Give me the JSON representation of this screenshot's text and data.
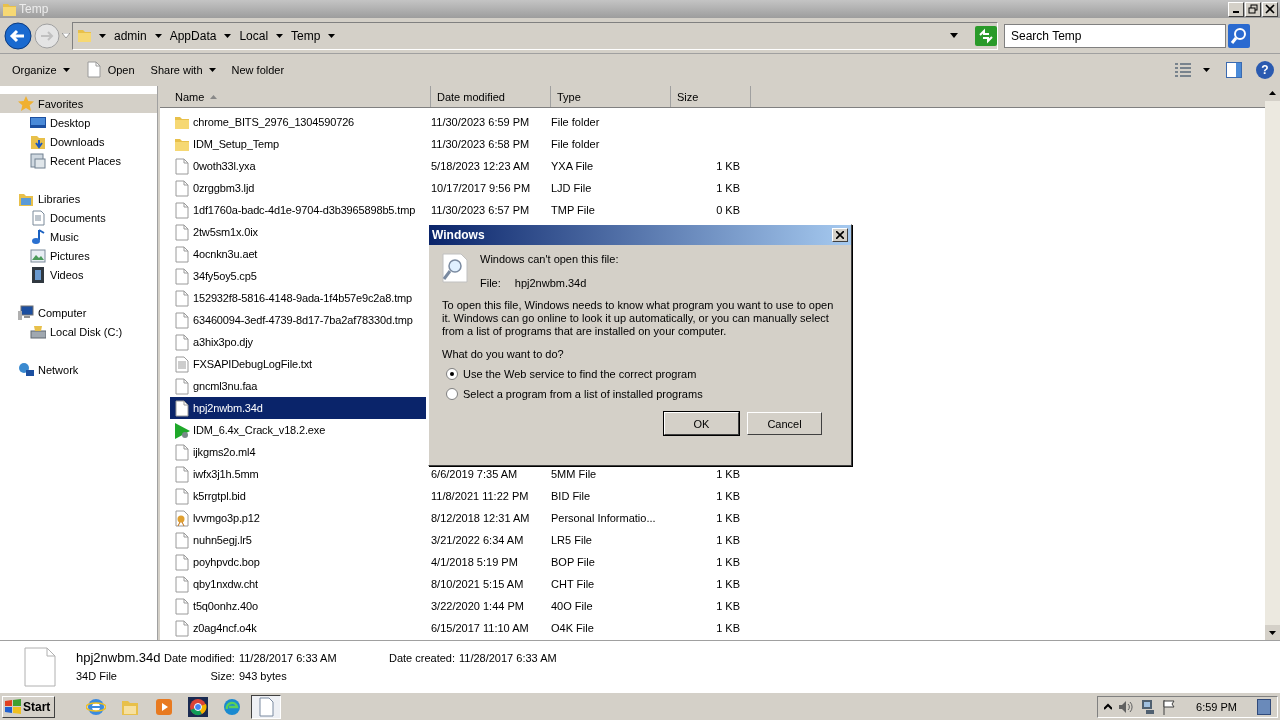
{
  "window": {
    "title": "Temp"
  },
  "address": {
    "crumbs": [
      "admin",
      "AppData",
      "Local",
      "Temp"
    ]
  },
  "search": {
    "placeholder": "Search Temp"
  },
  "toolbar": [
    {
      "label": "Organize",
      "kind": "menu"
    },
    {
      "label": "Open",
      "kind": "open"
    },
    {
      "label": "Share with",
      "kind": "menu"
    },
    {
      "label": "New folder",
      "kind": "plain"
    }
  ],
  "sidebar": [
    {
      "label": "Favorites",
      "kind": "favorites",
      "selected": true,
      "children": [
        {
          "label": "Desktop",
          "kind": "desktop"
        },
        {
          "label": "Downloads",
          "kind": "downloads"
        },
        {
          "label": "Recent Places",
          "kind": "recent"
        }
      ]
    },
    {
      "label": "Libraries",
      "kind": "libraries",
      "selected": false,
      "children": [
        {
          "label": "Documents",
          "kind": "documents"
        },
        {
          "label": "Music",
          "kind": "music"
        },
        {
          "label": "Pictures",
          "kind": "pictures"
        },
        {
          "label": "Videos",
          "kind": "videos"
        }
      ]
    },
    {
      "label": "Computer",
      "kind": "computer",
      "selected": false,
      "children": [
        {
          "label": "Local Disk (C:)",
          "kind": "disk"
        }
      ]
    },
    {
      "label": "Network",
      "kind": "network",
      "selected": false
    }
  ],
  "help": "?",
  "columns": [
    {
      "label": "Name",
      "sorted": true
    },
    {
      "label": "Date modified",
      "sorted": false
    },
    {
      "label": "Type",
      "sorted": false
    },
    {
      "label": "Size",
      "sorted": false
    }
  ],
  "files": [
    {
      "name": "chrome_BITS_2976_1304590726",
      "kind": "folder",
      "date": "11/30/2023 6:59 PM",
      "type": "File folder",
      "selected": false
    },
    {
      "name": "IDM_Setup_Temp",
      "kind": "folder",
      "date": "11/30/2023 6:58 PM",
      "type": "File folder",
      "selected": false
    },
    {
      "name": "0woth33l.yxa",
      "kind": "file",
      "date": "5/18/2023 12:23 AM",
      "type": "YXA File",
      "size": "1 KB",
      "selected": false
    },
    {
      "name": "0zrggbm3.ljd",
      "kind": "file",
      "date": "10/17/2017 9:56 PM",
      "type": "LJD File",
      "size": "1 KB",
      "selected": false
    },
    {
      "name": "1df1760a-badc-4d1e-9704-d3b3965898b5.tmp",
      "kind": "file",
      "date": "11/30/2023 6:57 PM",
      "type": "TMP File",
      "size": "0 KB",
      "selected": false
    },
    {
      "name": "2tw5sm1x.0ix",
      "kind": "file",
      "selected": false
    },
    {
      "name": "4ocnkn3u.aet",
      "kind": "file",
      "selected": false
    },
    {
      "name": "34fy5oy5.cp5",
      "kind": "file",
      "selected": false
    },
    {
      "name": "152932f8-5816-4148-9ada-1f4b57e9c2a8.tmp",
      "kind": "file",
      "selected": false
    },
    {
      "name": "63460094-3edf-4739-8d17-7ba2af78330d.tmp",
      "kind": "file",
      "selected": false
    },
    {
      "name": "a3hix3po.djy",
      "kind": "file",
      "selected": false
    },
    {
      "name": "FXSAPIDebugLogFile.txt",
      "kind": "text",
      "selected": false
    },
    {
      "name": "gncml3nu.faa",
      "kind": "file",
      "selected": false
    },
    {
      "name": "hpj2nwbm.34d",
      "kind": "file",
      "selected": true
    },
    {
      "name": "IDM_6.4x_Crack_v18.2.exe",
      "kind": "exe",
      "selected": false
    },
    {
      "name": "ijkgms2o.ml4",
      "kind": "file",
      "selected": false
    },
    {
      "name": "iwfx3j1h.5mm",
      "kind": "file",
      "date": "6/6/2019 7:35 AM",
      "type": "5MM File",
      "size": "1 KB",
      "selected": false
    },
    {
      "name": "k5rrgtpl.bid",
      "kind": "file",
      "date": "11/8/2021 11:22 PM",
      "type": "BID File",
      "size": "1 KB",
      "selected": false
    },
    {
      "name": "lvvmgo3p.p12",
      "kind": "cert",
      "date": "8/12/2018 12:31 AM",
      "type": "Personal Informatio...",
      "size": "1 KB",
      "selected": false
    },
    {
      "name": "nuhn5egj.lr5",
      "kind": "file",
      "date": "3/21/2022 6:34 AM",
      "type": "LR5 File",
      "size": "1 KB",
      "selected": false
    },
    {
      "name": "poyhpvdc.bop",
      "kind": "file",
      "date": "4/1/2018 5:19 PM",
      "type": "BOP File",
      "size": "1 KB",
      "selected": false
    },
    {
      "name": "qby1nxdw.cht",
      "kind": "file",
      "date": "8/10/2021 5:15 AM",
      "type": "CHT File",
      "size": "1 KB",
      "selected": false
    },
    {
      "name": "t5q0onhz.40o",
      "kind": "file",
      "date": "3/22/2020 1:44 PM",
      "type": "40O File",
      "size": "1 KB",
      "selected": false
    },
    {
      "name": "z0ag4ncf.o4k",
      "kind": "file",
      "date": "6/15/2017 11:10 AM",
      "type": "O4K File",
      "size": "1 KB",
      "selected": false
    }
  ],
  "dialog": {
    "title": "Windows",
    "heading": "Windows can't open this file:",
    "file_label": "File:",
    "file_name": "hpj2nwbm.34d",
    "body": "To open this file, Windows needs to know what program you want to use to open it. Windows can go online to look it up automatically, or you can manually select from a list of programs that are installed on your computer.",
    "question": "What do you want to do?",
    "options": [
      {
        "label": "Use the Web service to find the correct program",
        "selected": true
      },
      {
        "label": "Select a program from a list of installed programs",
        "selected": false
      }
    ],
    "buttons": [
      {
        "label": "OK",
        "default": true
      },
      {
        "label": "Cancel",
        "default": false
      }
    ]
  },
  "details": {
    "name": "hpj2nwbm.34d",
    "type": "34D File",
    "modified_label": "Date modified:",
    "modified": "11/28/2017 6:33 AM",
    "created_label": "Date created:",
    "created": "11/28/2017 6:33 AM",
    "size_label": "Size:",
    "size": "943 bytes"
  },
  "taskbar": {
    "start": "Start",
    "apps": [
      {
        "kind": "ie",
        "active": false
      },
      {
        "kind": "explorer",
        "active": false
      },
      {
        "kind": "media",
        "active": false
      },
      {
        "kind": "chrome",
        "active": false
      },
      {
        "kind": "edge",
        "active": false
      },
      {
        "kind": "file",
        "active": true
      }
    ],
    "clock": "6:59 PM"
  }
}
